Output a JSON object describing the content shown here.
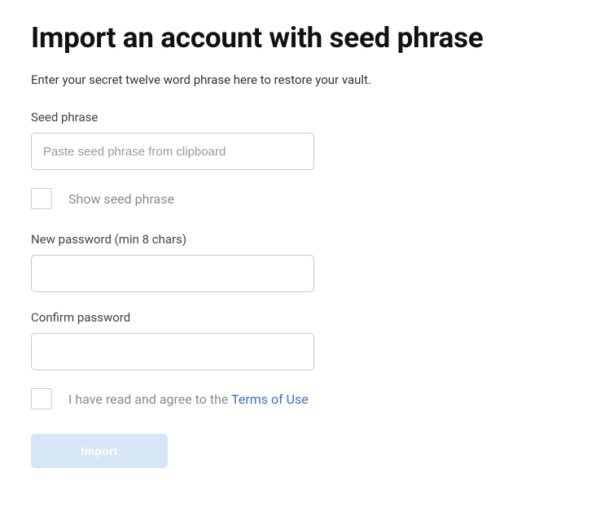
{
  "title": "Import an account with seed phrase",
  "subtitle": "Enter your secret twelve word phrase here to restore your vault.",
  "seed": {
    "label": "Seed phrase",
    "placeholder": "Paste seed phrase from clipboard",
    "value": ""
  },
  "show_seed": {
    "label": "Show seed phrase",
    "checked": false
  },
  "new_password": {
    "label": "New password (min 8 chars)",
    "value": ""
  },
  "confirm_password": {
    "label": "Confirm password",
    "value": ""
  },
  "terms": {
    "prefix": "I have read and agree to the ",
    "link_text": "Terms of Use",
    "checked": false
  },
  "import_button": "Import",
  "colors": {
    "link": "#3a6dcc",
    "button_disabled_bg": "#d6e6f7",
    "input_border": "#c9c9c9"
  }
}
